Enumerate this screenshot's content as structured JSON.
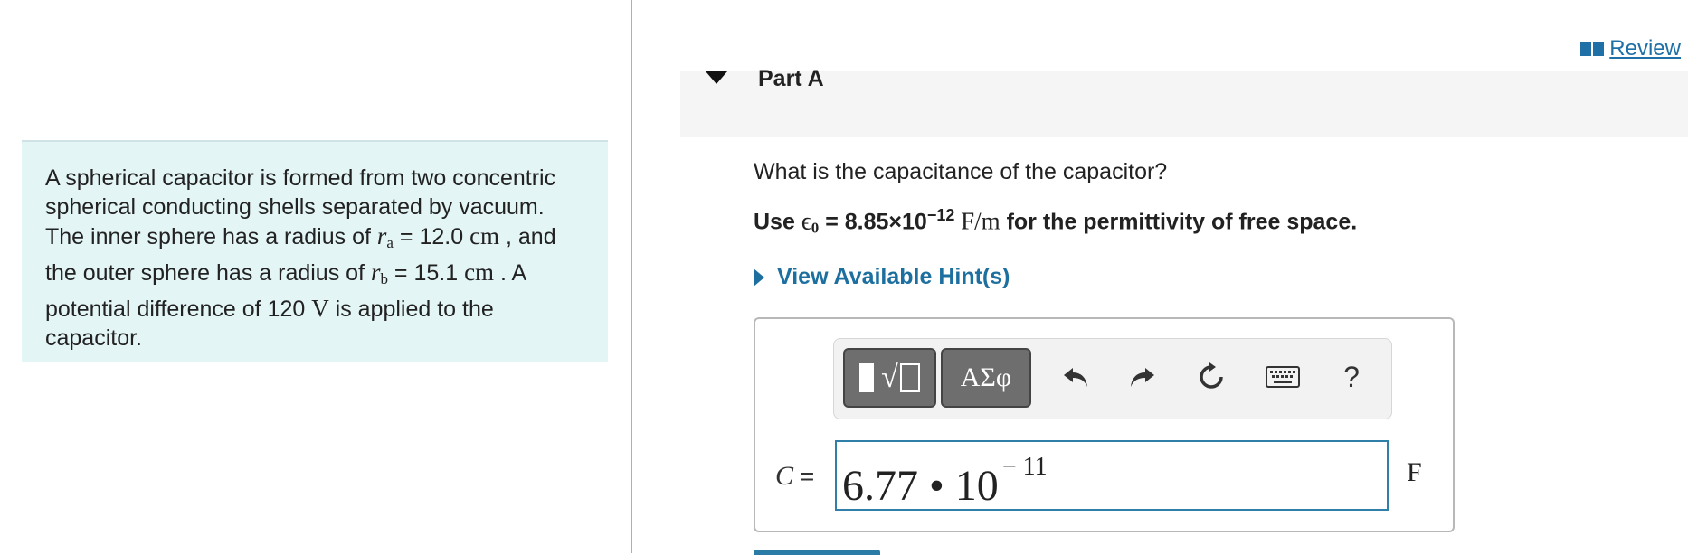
{
  "review": {
    "label": "Review",
    "icon": "book-icon"
  },
  "problem": {
    "text_1": "A spherical capacitor is formed from two concentric spherical conducting shells separated by vacuum. The inner sphere has a radius of ",
    "ra_symbol": "r",
    "ra_sub": "a",
    "ra_eq": " = 12.0 ",
    "ra_unit": "cm",
    "text_2": " , and the outer sphere has a radius of ",
    "rb_symbol": "r",
    "rb_sub": "b",
    "rb_eq": " = 15.1 ",
    "rb_unit": "cm",
    "text_3": " . A potential difference of 120 ",
    "v_unit": "V",
    "text_4": " is applied to the capacitor."
  },
  "part": {
    "title": "Part A"
  },
  "question": {
    "text": "What is the capacitance of the capacitor?",
    "use_prefix": "Use ",
    "epsilon": "ϵ",
    "epsilon_sub": "0",
    "use_value": " = 8.85×10",
    "use_exp": "−12",
    "use_unit": " F/m",
    "use_suffix": " for the permittivity of free space."
  },
  "hint": {
    "label": "View Available Hint(s)"
  },
  "toolbar": {
    "greek_label": "ΑΣφ",
    "help_label": "?",
    "icons": [
      "templates-icon",
      "greek-icon",
      "undo-icon",
      "redo-icon",
      "reset-icon",
      "keyboard-icon",
      "help-icon"
    ]
  },
  "answer": {
    "var_label": "C",
    "eq": " =",
    "mantissa": "6.77 • 10",
    "exponent": "− 11",
    "unit": "F"
  },
  "colors": {
    "accent": "#1c6f9e",
    "problem_bg": "#e4f5f6",
    "input_border": "#2f7fa8"
  }
}
